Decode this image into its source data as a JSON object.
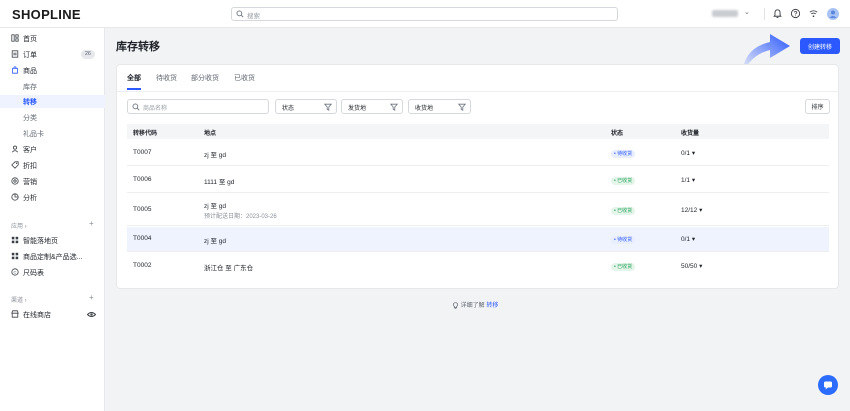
{
  "app": {
    "logo": "SHOPLINE"
  },
  "topbar": {
    "search_placeholder": "搜索",
    "store_chevron": "⌄"
  },
  "sidebar": {
    "items": [
      {
        "label": "首页",
        "icon": "dashboard-icon"
      },
      {
        "label": "订单",
        "icon": "order-icon",
        "badge": "26"
      },
      {
        "label": "商品",
        "icon": "product-icon"
      },
      {
        "label": "库存",
        "sub": true
      },
      {
        "label": "转移",
        "sub": true,
        "active": true
      },
      {
        "label": "分类",
        "sub": true
      },
      {
        "label": "礼品卡",
        "sub": true
      },
      {
        "label": "客户",
        "icon": "customer-icon"
      },
      {
        "label": "折扣",
        "icon": "discount-icon"
      },
      {
        "label": "营销",
        "icon": "marketing-icon"
      },
      {
        "label": "分析",
        "icon": "analytics-icon"
      }
    ],
    "apps_section": "应用 ›",
    "apps": [
      {
        "label": "智能落地页",
        "icon": "grid-icon"
      },
      {
        "label": "商品定制&产品选...",
        "icon": "grid-icon"
      },
      {
        "label": "尺码表",
        "icon": "size-chart-icon"
      }
    ],
    "channels_section": "渠道 ›",
    "channels": [
      {
        "label": "在线商店",
        "icon": "store-icon"
      }
    ]
  },
  "page": {
    "title": "库存转移",
    "create_button": "创建转移"
  },
  "tabs": [
    "全部",
    "待收货",
    "部分收货",
    "已收货"
  ],
  "filters": {
    "search_placeholder": "商品名称",
    "status": "状态",
    "ship_from": "发货地",
    "receive_at": "收货地",
    "sort": "排序"
  },
  "table": {
    "headers": [
      "转移代码",
      "地点",
      "状态",
      "收货量"
    ],
    "rows": [
      {
        "code": "T0007",
        "place": "zj 至 gd",
        "expected": "",
        "status": "• 待收货",
        "status_type": "pending",
        "qty": "0/1 ▾"
      },
      {
        "code": "T0006",
        "place": "1111 至 gd",
        "expected": "",
        "status": "• 已收货",
        "status_type": "received",
        "qty": "1/1 ▾"
      },
      {
        "code": "T0005",
        "place": "zj 至 gd",
        "expected": "预计配送日期：2023-03-26",
        "status": "• 已收货",
        "status_type": "received",
        "qty": "12/12 ▾"
      },
      {
        "code": "T0004",
        "place": "zj 至 gd",
        "expected": "",
        "status": "• 待收货",
        "status_type": "pending",
        "qty": "0/1 ▾"
      },
      {
        "code": "T0002",
        "place": "浙江仓 至 广东仓",
        "expected": "",
        "status": "• 已收货",
        "status_type": "received",
        "qty": "50/50 ▾"
      }
    ]
  },
  "footer": {
    "prefix": "详细了解",
    "link": "转移"
  },
  "colors": {
    "accent": "#2b59ff",
    "received": "#1e9e55"
  }
}
